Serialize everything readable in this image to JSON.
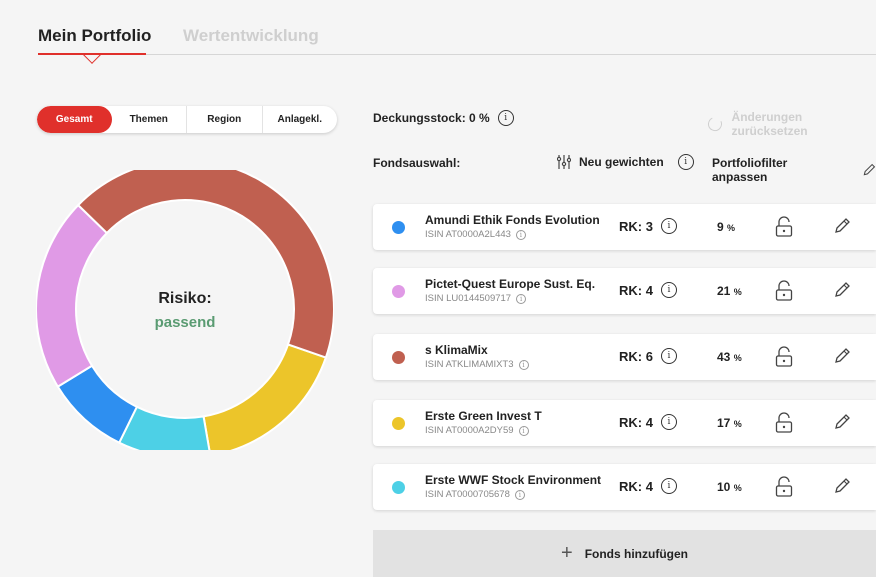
{
  "tabs": [
    {
      "label": "Mein Portfolio",
      "active": true
    },
    {
      "label": "Wertentwicklung",
      "active": false
    }
  ],
  "segments": [
    {
      "label": "Gesamt",
      "active": true
    },
    {
      "label": "Themen",
      "active": false
    },
    {
      "label": "Region",
      "active": false
    },
    {
      "label": "Anlagekl.",
      "active": false
    }
  ],
  "risk": {
    "label": "Risiko:",
    "value": "passend",
    "value_color": "#5a9b72"
  },
  "deckungsstock": {
    "label": "Deckungsstock: 0 %"
  },
  "reset": {
    "label": "Änderungen zurücksetzen"
  },
  "fondsauswahl": {
    "label": "Fondsauswahl:"
  },
  "reweight": {
    "label": "Neu gewichten"
  },
  "filter": {
    "label": "Portfoliofilter anpassen"
  },
  "funds": [
    {
      "name": "Amundi Ethik Fonds Evolution",
      "isin": "ISIN AT0000A2L443",
      "rk": "RK: 3",
      "pct": "9",
      "unit": "%",
      "weight": 9,
      "color": "#2e8ff0"
    },
    {
      "name": "Pictet-Quest Europe Sust. Eq.",
      "isin": "ISIN LU0144509717",
      "rk": "RK: 4",
      "pct": "21",
      "unit": "%",
      "weight": 21,
      "color": "#e09ae6"
    },
    {
      "name": "s KlimaMix",
      "isin": "ISIN ATKLIMAMIXT3",
      "rk": "RK: 6",
      "pct": "43",
      "unit": "%",
      "weight": 43,
      "color": "#c06050"
    },
    {
      "name": "Erste Green Invest T",
      "isin": "ISIN AT0000A2DY59",
      "rk": "RK: 4",
      "pct": "17",
      "unit": "%",
      "weight": 17,
      "color": "#ecc52a"
    },
    {
      "name": "Erste WWF Stock Environment",
      "isin": "ISIN AT0000705678",
      "rk": "RK: 4",
      "pct": "10",
      "unit": "%",
      "weight": 10,
      "color": "#4dd0e6"
    }
  ],
  "add_fund": {
    "label": "Fonds hinzufügen"
  },
  "icons": {
    "info": "info-icon",
    "lock": "unlocked-lock-icon",
    "pencil": "pencil-icon",
    "undo": "undo-icon",
    "sliders": "sliders-icon",
    "plus": "plus-icon"
  },
  "colors": {
    "accent": "#e0302b"
  }
}
